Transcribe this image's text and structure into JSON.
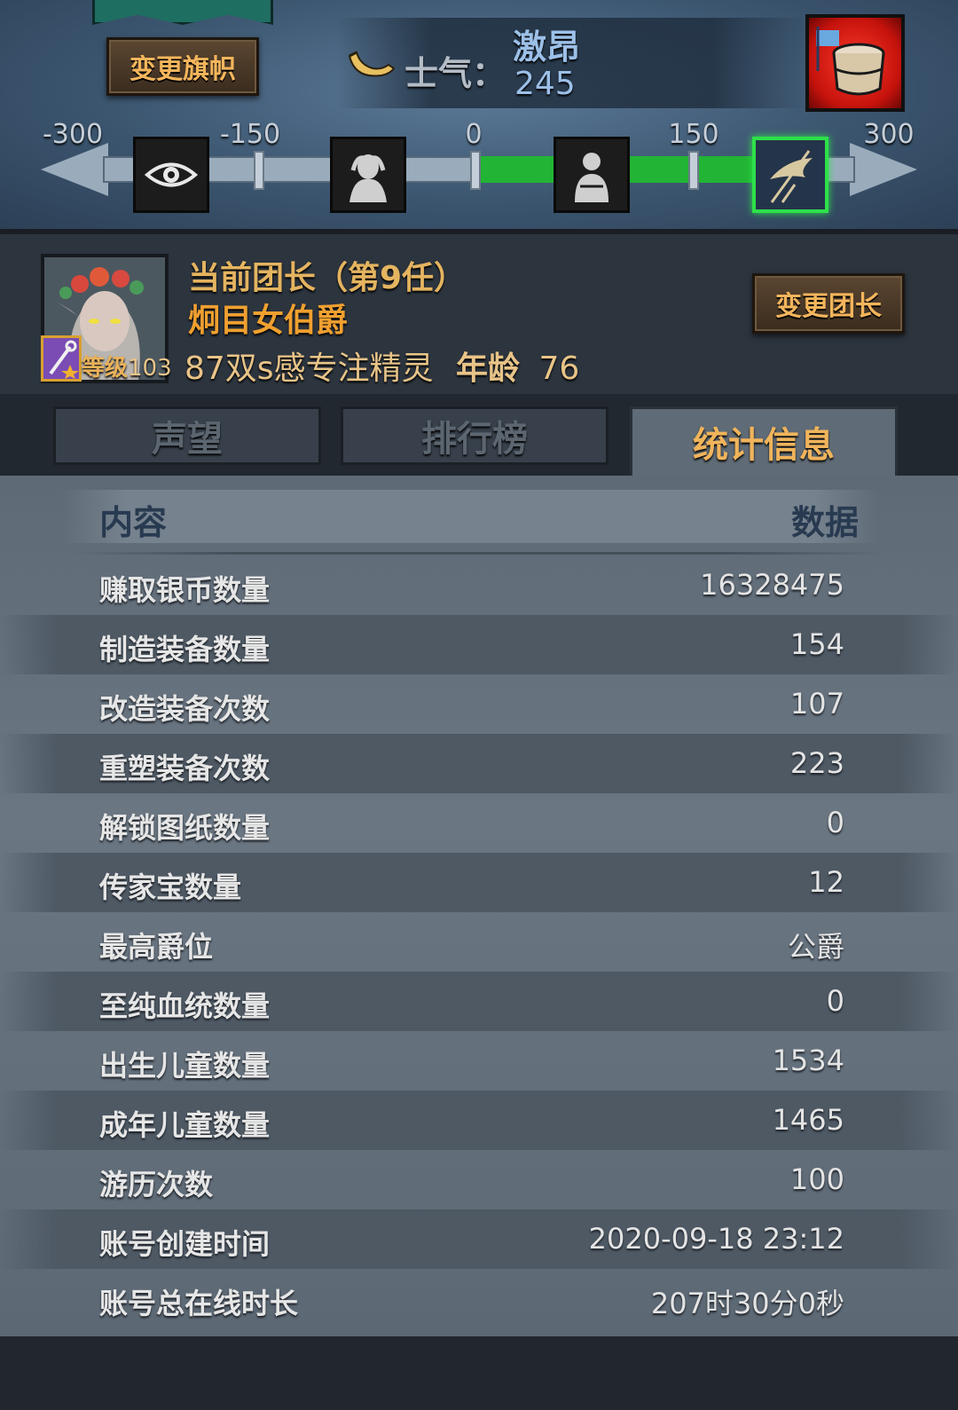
{
  "banner": {
    "change_flag_label": "变更旗帜"
  },
  "morale": {
    "label": "士气：",
    "status": "激昂",
    "value": "245",
    "scale_labels": [
      "-300",
      "-150",
      "0",
      "150",
      "300"
    ],
    "current_value": 245,
    "range": [
      -300,
      300
    ],
    "icons": [
      "eye-icon",
      "despair-icon",
      "calm-icon",
      "banner-charge-icon"
    ],
    "active_icon": "banner-charge-icon",
    "reward_icon": "drum-icon"
  },
  "leader": {
    "title": "当前团长（第9任）",
    "name": "炯目女伯爵",
    "level_label": "等级",
    "level": "103",
    "description": "87双s感专注精灵",
    "age_label": "年龄",
    "age": "76",
    "change_leader_label": "变更团长"
  },
  "tabs": [
    {
      "label": "声望",
      "active": false
    },
    {
      "label": "排行榜",
      "active": false
    },
    {
      "label": "统计信息",
      "active": true
    }
  ],
  "stats": {
    "header_content": "内容",
    "header_data": "数据",
    "rows": [
      {
        "key": "赚取银币数量",
        "value": "16328475"
      },
      {
        "key": "制造装备数量",
        "value": "154"
      },
      {
        "key": "改造装备次数",
        "value": "107"
      },
      {
        "key": "重塑装备次数",
        "value": "223"
      },
      {
        "key": "解锁图纸数量",
        "value": "0"
      },
      {
        "key": "传家宝数量",
        "value": "12"
      },
      {
        "key": "最高爵位",
        "value": "公爵"
      },
      {
        "key": "至纯血统数量",
        "value": "0"
      },
      {
        "key": "出生儿童数量",
        "value": "1534"
      },
      {
        "key": "成年儿童数量",
        "value": "1465"
      },
      {
        "key": "游历次数",
        "value": "100"
      },
      {
        "key": "账号创建时间",
        "value": "2020-09-18 23:12"
      },
      {
        "key": "账号总在线时长",
        "value": "207时30分0秒"
      }
    ]
  },
  "colors": {
    "accent_gold": "#f0b45c",
    "morale_green": "#22b434",
    "status_blue": "#9cc0e8"
  }
}
